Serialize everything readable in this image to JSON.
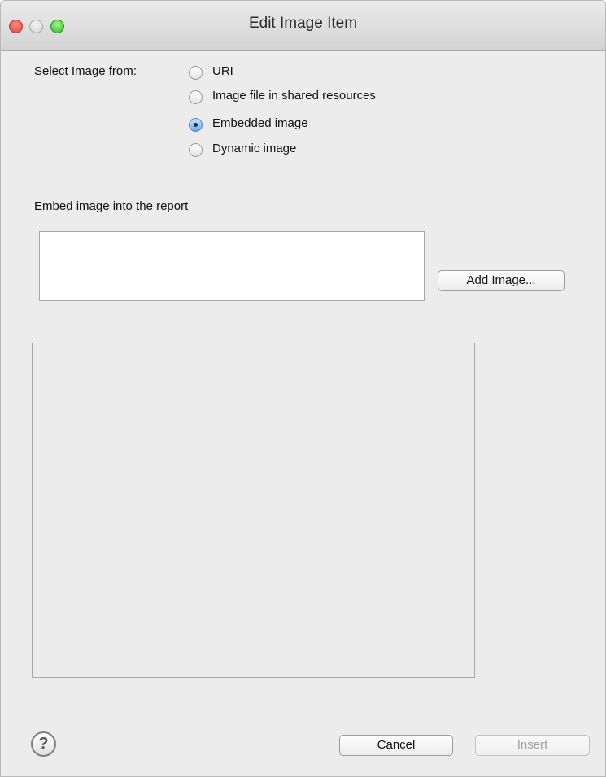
{
  "window": {
    "title": "Edit Image Item"
  },
  "select_image": {
    "label": "Select Image from:",
    "options": [
      {
        "label": "URI",
        "selected": false
      },
      {
        "label": "Image file in shared resources",
        "selected": false
      },
      {
        "label": "Embedded image",
        "selected": true
      },
      {
        "label": "Dynamic image",
        "selected": false
      }
    ]
  },
  "embed": {
    "label": "Embed image into the report",
    "add_button": "Add Image..."
  },
  "footer": {
    "help_icon": "question-mark-icon",
    "help_glyph": "?",
    "cancel_button": "Cancel",
    "insert_button": "Insert"
  },
  "colors": {
    "window_bg": "#ececec",
    "close": "#e0443b",
    "maximize": "#39b42b",
    "radio_selected": "#6fa9ee"
  }
}
